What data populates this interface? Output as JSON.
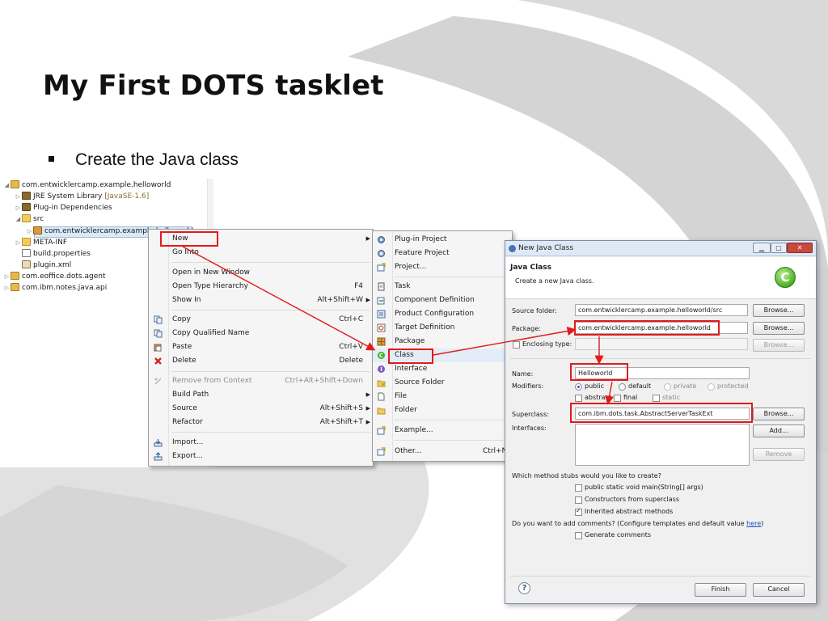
{
  "slide": {
    "title": "My First DOTS tasklet",
    "bullet": "Create the Java class"
  },
  "explorer": {
    "rows": [
      {
        "twisty": "◢",
        "icon": "project-icon",
        "label": "com.entwicklercamp.example.helloworld",
        "suffix": ""
      },
      {
        "twisty": "▷",
        "icon": "library-icon",
        "label": "JRE System Library ",
        "suffix": "[JavaSE-1.6]"
      },
      {
        "twisty": "▷",
        "icon": "library-icon",
        "label": "Plug-in Dependencies",
        "suffix": ""
      },
      {
        "twisty": "◢",
        "icon": "source-folder-icon",
        "label": "src",
        "suffix": ""
      },
      {
        "twisty": "▷",
        "icon": "package-icon",
        "label": "com.entwicklercamp.example.helloworld",
        "suffix": ""
      },
      {
        "twisty": "▷",
        "icon": "folder-icon",
        "label": "META-INF",
        "suffix": ""
      },
      {
        "twisty": "",
        "icon": "properties-file-icon",
        "label": "build.properties",
        "suffix": ""
      },
      {
        "twisty": "",
        "icon": "xml-file-icon",
        "label": "plugin.xml",
        "suffix": ""
      },
      {
        "twisty": "▷",
        "icon": "project-icon",
        "label": "com.eoffice.dots.agent",
        "suffix": ""
      },
      {
        "twisty": "▷",
        "icon": "project-icon",
        "label": "com.ibm.notes.java.api",
        "suffix": ""
      }
    ]
  },
  "context_menu": {
    "items": [
      {
        "label": "New",
        "shortcut": "",
        "submenu": true,
        "icon": ""
      },
      {
        "label": "Go Into",
        "shortcut": "",
        "submenu": false,
        "icon": ""
      },
      {
        "label": "Open in New Window",
        "shortcut": "",
        "submenu": false,
        "icon": ""
      },
      {
        "label": "Open Type Hierarchy",
        "shortcut": "F4",
        "submenu": false,
        "icon": ""
      },
      {
        "label": "Show In",
        "shortcut": "Alt+Shift+W",
        "submenu": true,
        "icon": ""
      },
      {
        "label": "Copy",
        "shortcut": "Ctrl+C",
        "submenu": false,
        "icon": "copy-icon"
      },
      {
        "label": "Copy Qualified Name",
        "shortcut": "",
        "submenu": false,
        "icon": "copy-qualified-name-icon"
      },
      {
        "label": "Paste",
        "shortcut": "Ctrl+V",
        "submenu": false,
        "icon": "paste-icon"
      },
      {
        "label": "Delete",
        "shortcut": "Delete",
        "submenu": false,
        "icon": "delete-icon"
      },
      {
        "label": "Remove from Context",
        "shortcut": "Ctrl+Alt+Shift+Down",
        "submenu": false,
        "icon": "remove-context-icon",
        "disabled": true
      },
      {
        "label": "Build Path",
        "shortcut": "",
        "submenu": true,
        "icon": ""
      },
      {
        "label": "Source",
        "shortcut": "Alt+Shift+S",
        "submenu": true,
        "icon": ""
      },
      {
        "label": "Refactor",
        "shortcut": "Alt+Shift+T",
        "submenu": true,
        "icon": ""
      },
      {
        "label": "Import...",
        "shortcut": "",
        "submenu": false,
        "icon": "import-icon"
      },
      {
        "label": "Export...",
        "shortcut": "",
        "submenu": false,
        "icon": "export-icon"
      }
    ]
  },
  "new_submenu": {
    "items": [
      {
        "label": "Plug-in Project",
        "shortcut": "",
        "icon": "plugin-project-icon"
      },
      {
        "label": "Feature Project",
        "shortcut": "",
        "icon": "feature-project-icon"
      },
      {
        "label": "Project...",
        "shortcut": "",
        "icon": "project-wizard-icon"
      },
      {
        "label": "Task",
        "shortcut": "",
        "icon": "task-icon"
      },
      {
        "label": "Component Definition",
        "shortcut": "",
        "icon": "component-definition-icon"
      },
      {
        "label": "Product Configuration",
        "shortcut": "",
        "icon": "product-configuration-icon"
      },
      {
        "label": "Target Definition",
        "shortcut": "",
        "icon": "target-definition-icon"
      },
      {
        "label": "Package",
        "shortcut": "",
        "icon": "package-icon"
      },
      {
        "label": "Class",
        "shortcut": "",
        "icon": "class-icon"
      },
      {
        "label": "Interface",
        "shortcut": "",
        "icon": "interface-icon"
      },
      {
        "label": "Source Folder",
        "shortcut": "",
        "icon": "source-folder-icon"
      },
      {
        "label": "File",
        "shortcut": "",
        "icon": "file-icon"
      },
      {
        "label": "Folder",
        "shortcut": "",
        "icon": "folder-icon"
      },
      {
        "label": "Example...",
        "shortcut": "",
        "icon": "example-icon"
      },
      {
        "label": "Other...",
        "shortcut": "Ctrl+N",
        "icon": "other-wizard-icon"
      }
    ]
  },
  "dialog": {
    "window_title": "New Java Class",
    "header_title": "Java Class",
    "header_subtitle": "Create a new Java class.",
    "logo_glyph": "C",
    "source_folder": {
      "label": "Source folder:",
      "value": "com.entwicklercamp.example.helloworld/src",
      "button": "Browse..."
    },
    "package": {
      "label": "Package:",
      "value": "com.entwicklercamp.example.helloworld",
      "button": "Browse..."
    },
    "enclosing": {
      "label": "Enclosing type:",
      "value": "",
      "button": "Browse..."
    },
    "name": {
      "label": "Name:",
      "value": "Helloworld"
    },
    "modifiers": {
      "label": "Modifiers:",
      "access": [
        "public",
        "default",
        "private",
        "protected"
      ],
      "selected": "public",
      "flags": [
        "abstract",
        "final",
        "static"
      ]
    },
    "superclass": {
      "label": "Superclass:",
      "value": "com.ibm.dots.task.AbstractServerTaskExt",
      "button": "Browse..."
    },
    "interfaces": {
      "label": "Interfaces:",
      "add": "Add...",
      "remove": "Remove"
    },
    "stubs": {
      "question": "Which method stubs would you like to create?",
      "options": [
        {
          "label": "public static void main(String[] args)",
          "checked": false
        },
        {
          "label": "Constructors from superclass",
          "checked": false
        },
        {
          "label": "Inherited abstract methods",
          "checked": true
        }
      ]
    },
    "comments": {
      "question": "Do you want to add comments? (Configure templates and default value ",
      "link": "here",
      "question_end": ")",
      "option": "Generate comments",
      "checked": false
    },
    "help": "?",
    "finish": "Finish",
    "cancel": "Cancel"
  },
  "colors": {
    "callout": "#e21a1a",
    "accent": "#4a72b8"
  }
}
